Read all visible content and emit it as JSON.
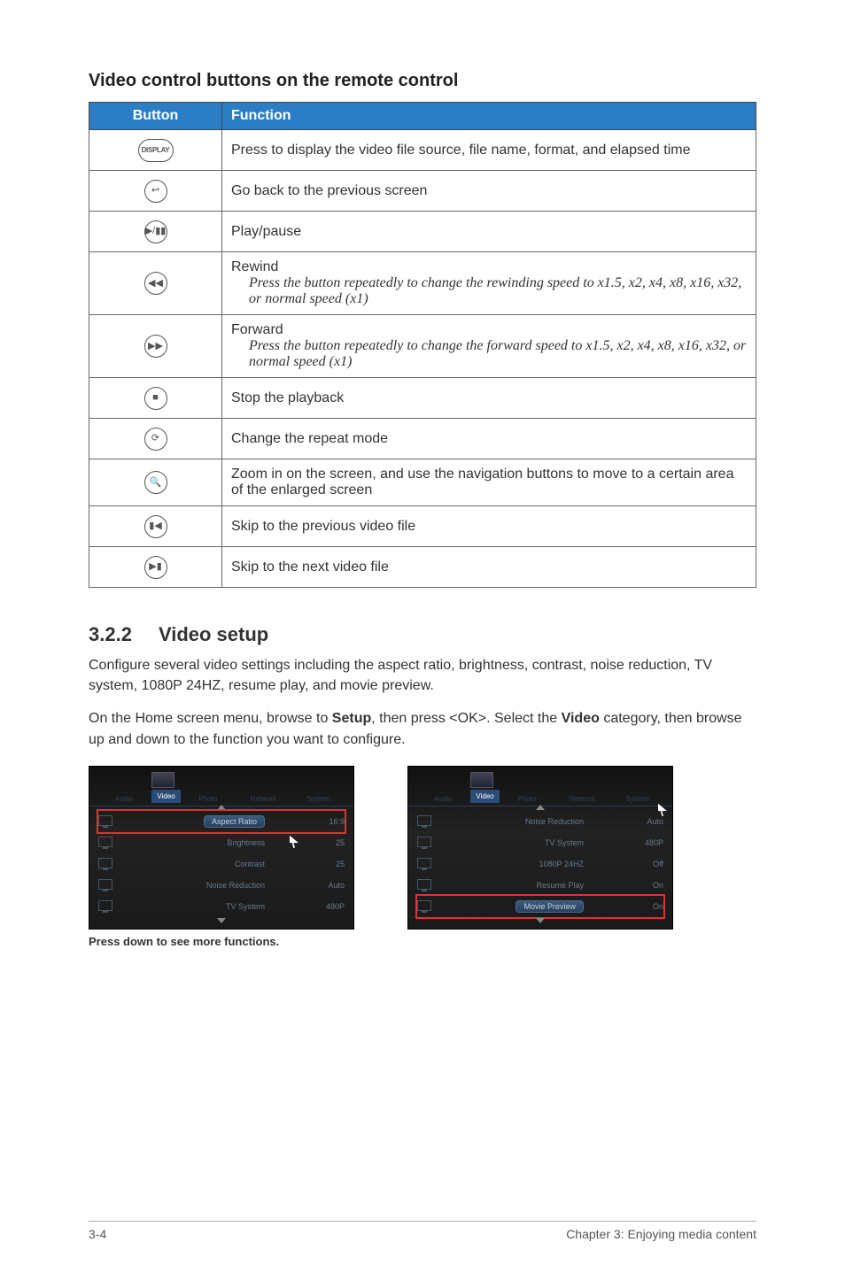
{
  "heading1": "Video control buttons on the remote control",
  "table": {
    "header_button": "Button",
    "header_function": "Function",
    "rows": [
      {
        "icon": "DISPLAY",
        "icon_style": "wide",
        "fn": "Press to display the video file source, file name, format, and elapsed time"
      },
      {
        "icon": "↩",
        "fn": "Go back to the previous screen"
      },
      {
        "icon": "▶/▮▮",
        "fn": "Play/pause"
      },
      {
        "icon": "◀◀",
        "fn": "Rewind",
        "fn_note": "Press the button repeatedly to change the rewinding speed to x1.5, x2, x4, x8, x16, x32, or normal speed (x1)"
      },
      {
        "icon": "▶▶",
        "fn": "Forward",
        "fn_note": "Press the button repeatedly to change the forward speed to x1.5, x2, x4, x8, x16, x32, or normal speed (x1)"
      },
      {
        "icon": "■",
        "fn": "Stop the playback"
      },
      {
        "icon": "⟳",
        "fn": "Change the repeat mode"
      },
      {
        "icon": "🔍",
        "fn": "Zoom in on the screen, and use the navigation buttons to move to a certain area of the enlarged screen"
      },
      {
        "icon": "▮◀",
        "fn": "Skip to the previous video file"
      },
      {
        "icon": "▶▮",
        "fn": "Skip to the next video file"
      }
    ]
  },
  "section": {
    "num": "3.2.2",
    "title": "Video setup"
  },
  "para1": "Configure several video settings including the aspect ratio, brightness, contrast, noise reduction, TV system, 1080P 24HZ, resume play, and movie preview.",
  "para2_a": "On the Home screen menu, browse to ",
  "para2_b": "Setup",
  "para2_c": ", then press <OK>. Select the ",
  "para2_d": "Video",
  "para2_e": " category, then browse up and down to the function you want to configure.",
  "tabs": {
    "audio": "Audio",
    "video": "Video",
    "photo": "Photo",
    "network": "Network",
    "system": "System"
  },
  "screen1": {
    "rows": [
      {
        "label": "Aspect Ratio",
        "val": "16:9",
        "hl": true,
        "pill": true
      },
      {
        "label": "Brightness",
        "val": "25"
      },
      {
        "label": "Contrast",
        "val": "25"
      },
      {
        "label": "Noise Reduction",
        "val": "Auto"
      },
      {
        "label": "TV System",
        "val": "480P"
      }
    ],
    "caption": "Press down to see more functions."
  },
  "screen2": {
    "rows": [
      {
        "label": "Noise Reduction",
        "val": "Auto"
      },
      {
        "label": "TV System",
        "val": "480P"
      },
      {
        "label": "1080P 24HZ",
        "val": "Off"
      },
      {
        "label": "Resume Play",
        "val": "On"
      },
      {
        "label": "Movie Preview",
        "val": "On",
        "hl": true,
        "pill": true
      }
    ]
  },
  "footer": {
    "left": "3-4",
    "right": "Chapter 3:  Enjoying media content"
  }
}
